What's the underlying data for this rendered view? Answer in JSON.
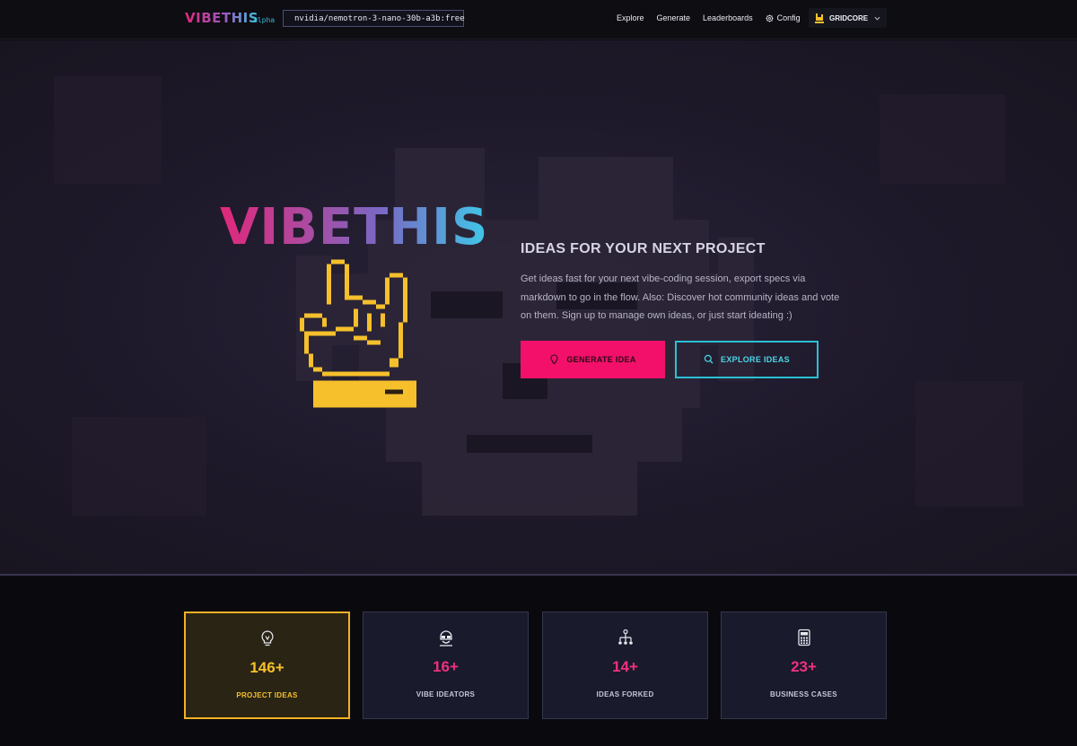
{
  "nav": {
    "logo": "VIBETHIS",
    "logo_tag": "alpha",
    "model": "nvidia/nemotron-3-nano-30b-a3b:free",
    "links": [
      "Explore",
      "Generate",
      "Leaderboards",
      "Config"
    ],
    "user": "GRIDCORE"
  },
  "hero": {
    "logo": "VIBETHIS",
    "tagline": "IDEAS FOR YOUR NEXT PROJECT",
    "description": "Get ideas fast for your next vibe-coding session, export specs via markdown to go in the flow. Also: Discover hot community ideas and vote on them. Sign up to manage own ideas, or just start ideating :)",
    "generate_label": "GENERATE IDEA",
    "explore_label": "EXPLORE IDEAS"
  },
  "stats": [
    {
      "value": "146+",
      "label": "PROJECT IDEAS",
      "icon": "lightbulb-icon"
    },
    {
      "value": "16+",
      "label": "VIBE IDEATORS",
      "icon": "hacker-icon"
    },
    {
      "value": "14+",
      "label": "IDEAS FORKED",
      "icon": "fork-tree-icon"
    },
    {
      "value": "23+",
      "label": "BUSINESS CASES",
      "icon": "calculator-icon"
    }
  ],
  "colors": {
    "accent_pink": "#f2106a",
    "accent_cyan": "#2bc0d4",
    "accent_yellow": "#f6c02c",
    "background": "#0b0b10"
  }
}
